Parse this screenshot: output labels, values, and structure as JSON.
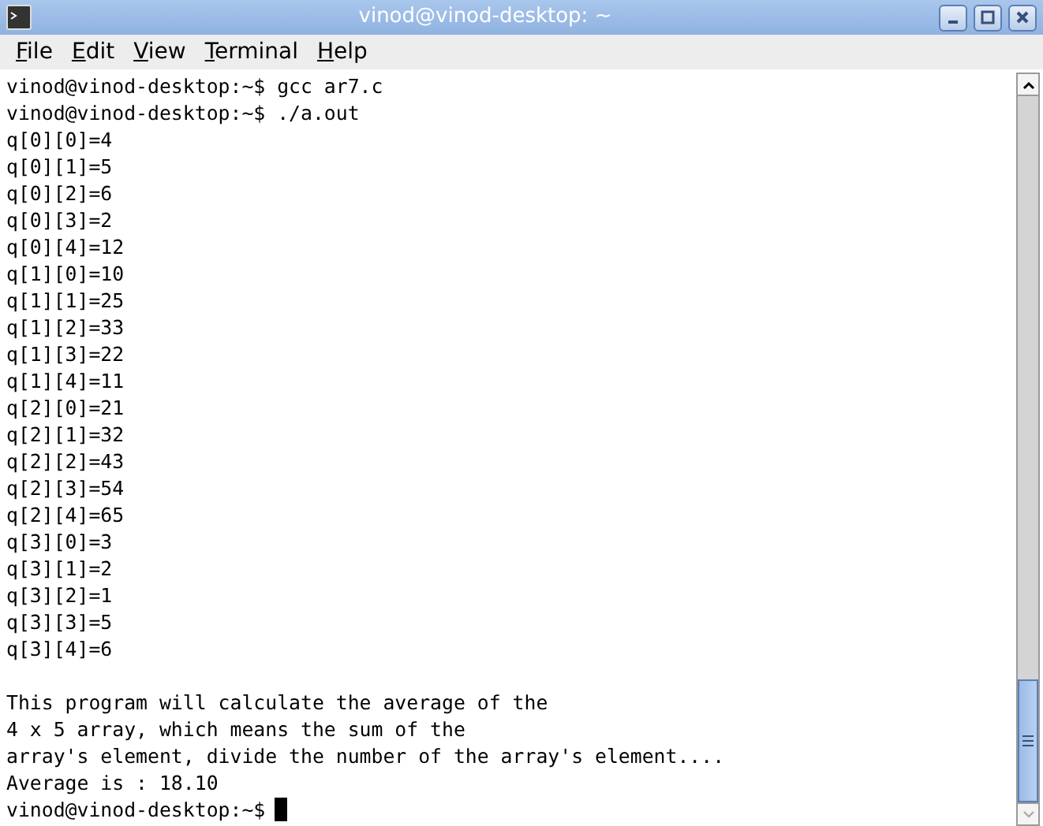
{
  "window": {
    "title": "vinod@vinod-desktop: ~"
  },
  "menu": [
    {
      "label": "File"
    },
    {
      "label": "Edit"
    },
    {
      "label": "View"
    },
    {
      "label": "Terminal"
    },
    {
      "label": "Help"
    }
  ],
  "terminal": {
    "blocks": [
      [
        "vinod@vinod-desktop:~$ gcc ar7.c",
        "vinod@vinod-desktop:~$ ./a.out",
        "q[0][0]=4",
        "q[0][1]=5",
        "q[0][2]=6",
        "q[0][3]=2",
        "q[0][4]=12",
        "q[1][0]=10",
        "q[1][1]=25",
        "q[1][2]=33",
        "q[1][3]=22",
        "q[1][4]=11",
        "q[2][0]=21",
        "q[2][1]=32",
        "q[2][2]=43",
        "q[2][3]=54",
        "q[2][4]=65",
        "q[3][0]=3",
        "q[3][1]=2",
        "q[3][2]=1",
        "q[3][3]=5",
        "q[3][4]=6"
      ],
      [
        "This program will calculate the average of the",
        "4 x 5 array, which means the sum of the",
        "array's element, divide the number of the array's element....",
        "Average is : 18.10",
        "vinod@vinod-desktop:~$"
      ]
    ],
    "cursor": true
  }
}
